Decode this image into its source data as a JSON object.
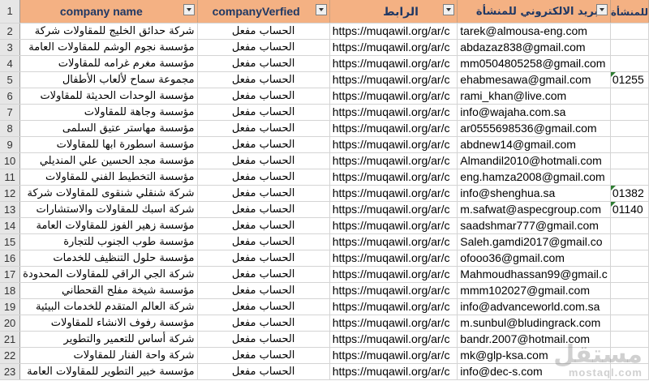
{
  "headers": [
    {
      "label": "company name"
    },
    {
      "label": "companyVerfied"
    },
    {
      "label": "الرابط"
    },
    {
      "label": "البريد الالكتروني للمنشأة"
    },
    {
      "label": "للمنشأة"
    }
  ],
  "header_row_number": "1",
  "rows": [
    {
      "n": "2",
      "name": "شركة حدائق الخليج للمقاولات شركة",
      "verified": "الحساب مفعل",
      "link": "https://muqawil.org/ar/c",
      "email": "tarek@almousa-eng.com",
      "extra": ""
    },
    {
      "n": "3",
      "name": "مؤسسة نجوم الوشم للمقاولات العامة",
      "verified": "الحساب مفعل",
      "link": "https://muqawil.org/ar/c",
      "email": "abdazaz838@gmail.com",
      "extra": ""
    },
    {
      "n": "4",
      "name": "مؤسسة مغرم غرامه للمقاولات",
      "verified": "الحساب مفعل",
      "link": "https://muqawil.org/ar/c",
      "email": "mm0504805258@gmail.com",
      "extra": ""
    },
    {
      "n": "5",
      "name": "مجموعة سماح لألعاب الأطفال",
      "verified": "الحساب مفعل",
      "link": "https://muqawil.org/ar/c",
      "email": "ehabmesawa@gmail.com",
      "extra": "01255"
    },
    {
      "n": "6",
      "name": "مؤسسة الوحدات الحديثة للمقاولات",
      "verified": "الحساب مفعل",
      "link": "https://muqawil.org/ar/c",
      "email": "rami_khan@live.com",
      "extra": ""
    },
    {
      "n": "7",
      "name": "مؤسسة وجاهة للمقاولات",
      "verified": "الحساب مفعل",
      "link": "https://muqawil.org/ar/c",
      "email": "info@wajaha.com.sa",
      "extra": ""
    },
    {
      "n": "8",
      "name": "مؤسسة مهاستر عتيق السلمى",
      "verified": "الحساب مفعل",
      "link": "https://muqawil.org/ar/c",
      "email": "ar0555698536@gmail.com",
      "extra": ""
    },
    {
      "n": "9",
      "name": "مؤسسة اسطورة ابها للمقاولات",
      "verified": "الحساب مفعل",
      "link": "https://muqawil.org/ar/c",
      "email": "abdnew14@gmail.com",
      "extra": ""
    },
    {
      "n": "10",
      "name": "مؤسسة مجد الحسين علي المنديلي",
      "verified": "الحساب مفعل",
      "link": "https://muqawil.org/ar/c",
      "email": "Almandil2010@hotmali.com",
      "extra": ""
    },
    {
      "n": "11",
      "name": "مؤسسة التخطيط الفني للمقاولات",
      "verified": "الحساب مفعل",
      "link": "https://muqawil.org/ar/c",
      "email": "eng.hamza2008@gmail.com",
      "extra": ""
    },
    {
      "n": "12",
      "name": "شركة شنقلي شنقوى للمقاولات شركة",
      "verified": "الحساب مفعل",
      "link": "https://muqawil.org/ar/c",
      "email": "info@shenghua.sa",
      "extra": "01382"
    },
    {
      "n": "13",
      "name": "شركة اسبك للمقاولات والاستشارات",
      "verified": "الحساب مفعل",
      "link": "https://muqawil.org/ar/c",
      "email": "m.safwat@aspecgroup.com",
      "extra": "01140"
    },
    {
      "n": "14",
      "name": "مؤسسة زهير الفوز للمقاولات العامة",
      "verified": "الحساب مفعل",
      "link": "https://muqawil.org/ar/c",
      "email": "saadshmar777@gmail.com",
      "extra": ""
    },
    {
      "n": "15",
      "name": "مؤسسة طوب الجنوب للتجارة",
      "verified": "الحساب مفعل",
      "link": "https://muqawil.org/ar/c",
      "email": "Saleh.gamdi2017@gmail.co",
      "extra": ""
    },
    {
      "n": "16",
      "name": "مؤسسة حلول التنظيف للخدمات",
      "verified": "الحساب مفعل",
      "link": "https://muqawil.org/ar/c",
      "email": "ofooo36@gmail.com",
      "extra": ""
    },
    {
      "n": "17",
      "name": "شركة الجي الراقي للمقاولات المحدودة",
      "verified": "الحساب مفعل",
      "link": "https://muqawil.org/ar/c",
      "email": "Mahmoudhassan99@gmail.c",
      "extra": ""
    },
    {
      "n": "18",
      "name": "مؤسسة شيخة مفلح القحطاني",
      "verified": "الحساب مفعل",
      "link": "https://muqawil.org/ar/c",
      "email": "mmm102027@gmail.com",
      "extra": ""
    },
    {
      "n": "19",
      "name": "شركة العالم المتقدم للخدمات البيئية",
      "verified": "الحساب مفعل",
      "link": "https://muqawil.org/ar/c",
      "email": "info@advanceworld.com.sa",
      "extra": ""
    },
    {
      "n": "20",
      "name": "مؤسسة رفوف الانشاء للمقاولات",
      "verified": "الحساب مفعل",
      "link": "https://muqawil.org/ar/c",
      "email": "m.sunbul@bludingrack.com",
      "extra": ""
    },
    {
      "n": "21",
      "name": "شركة أساس للتعمير والتطوير",
      "verified": "الحساب مفعل",
      "link": "https://muqawil.org/ar/c",
      "email": "bandr.2007@hotmail.com",
      "extra": ""
    },
    {
      "n": "22",
      "name": "شركة واحة الفنار للمقاولات",
      "verified": "الحساب مفعل",
      "link": "https://muqawil.org/ar/c",
      "email": "mk@glp-ksa.com",
      "extra": ""
    },
    {
      "n": "23",
      "name": "مؤسسة خبير التطوير للمقاولات العامة",
      "verified": "الحساب مفعل",
      "link": "https://muqawil.org/ar/c",
      "email": "info@dec-s.com",
      "extra": ""
    }
  ],
  "watermark": {
    "main": "مستقل",
    "sub": "mostaql.com"
  },
  "colors": {
    "header_fill": "#f4b183",
    "header_text": "#1f3864",
    "error_triangle": "#2e7d32"
  }
}
